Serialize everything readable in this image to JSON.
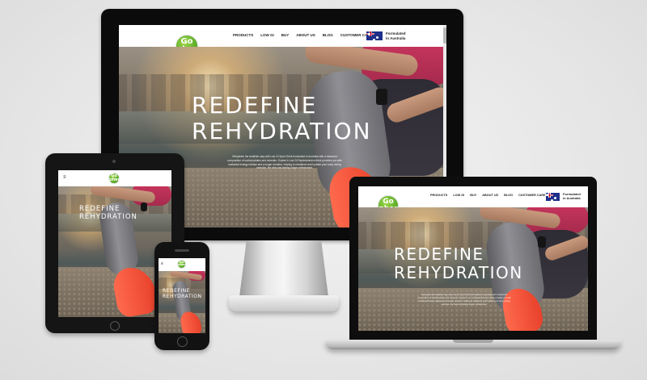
{
  "site": {
    "logo_line1": "Go",
    "logo_line2": "pher",
    "nav": [
      "PRODUCTS",
      "LOW GI",
      "BUY",
      "ABOUT US",
      "BLOG",
      "CUSTOMER CARE"
    ],
    "formulated_line1": "Formulated",
    "formulated_line2": "in Australia",
    "headline_line1": "REDEFINE",
    "headline_line2": "REHYDRATION",
    "sub_line1": "Rehydrate the healthier way with Low GI Sport Drink formulated in Australia with a balanced",
    "sub_line2": "composition of carbohydrates and minerals. Gopher's Low GI Replenishment drink provides you with",
    "sub_line3": "sustained energy release and a longer duration, helping to rebalance and hydrate your body during",
    "sub_line4": "exercise, the best and lasting longer refreshment."
  },
  "devices": [
    "desktop-monitor",
    "laptop",
    "tablet",
    "phone"
  ],
  "colors": {
    "logo_green": "#5fae2a",
    "accent_pink": "#c9365e",
    "shoe_orange": "#ff6a4d",
    "device_black": "#0b0b0b"
  }
}
